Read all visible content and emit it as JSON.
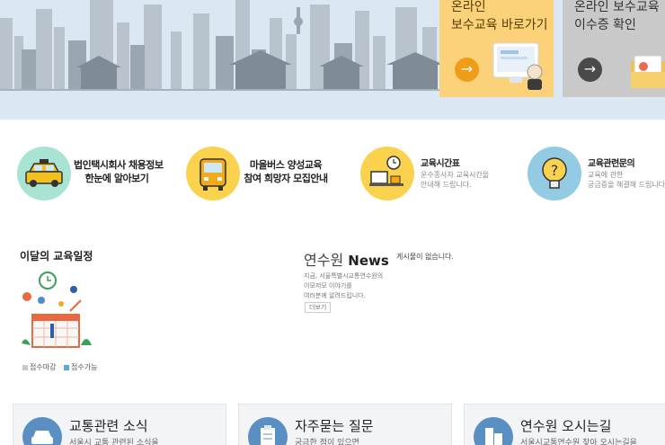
{
  "hero": {
    "cards": [
      {
        "line1": "온라인",
        "line2": "보수교육 바로가기",
        "arrow": "→"
      },
      {
        "line1": "온라인 보수교육",
        "line2": "이수증 확인",
        "arrow": "→"
      }
    ]
  },
  "quick_links": [
    {
      "line1": "법인택시회사 채용정보",
      "line2": "한눈에 알아보기",
      "icon": "taxi-icon"
    },
    {
      "line1": "마을버스 양성교육",
      "line2": "참여 희망자 모집안내",
      "icon": "bus-icon"
    },
    {
      "title": "교육시간표",
      "sub1": "운수종사자 교육시간을",
      "sub2": "안내해 드립니다.",
      "icon": "clock-desk-icon"
    },
    {
      "title": "교육관련문의",
      "sub1": "교육에 관한",
      "sub2": "궁금증을 해결해 드립니다.",
      "icon": "lightbulb-icon"
    }
  ],
  "schedule": {
    "title": "이달의 교육일정",
    "legend_closed": "접수마감",
    "legend_open": "접수가능"
  },
  "news": {
    "title_prefix": "연수원",
    "title_main": "News",
    "desc1": "지금, 서울특별시교통연수원의",
    "desc2": "이모저모 이야기를",
    "desc3": "여러분께 알려드립니다.",
    "more": "더보기",
    "empty": "게시물이 없습니다."
  },
  "bottom_cards": [
    {
      "title": "교통관련 소식",
      "sub": "서울시 교통 관련된 소식을"
    },
    {
      "title": "자주묻는 질문",
      "sub": "궁금한 점이 있으면"
    },
    {
      "title": "연수원 오시는길",
      "sub": "서울시교통연수원 찾아 오시는길을"
    }
  ],
  "colors": {
    "hero_bg": "#dbe8f4",
    "card_yellow": "#fbd27a",
    "card_gray": "#c9c9c9",
    "quick_mint": "#a9e3d3",
    "quick_yellow": "#fbd24e",
    "quick_blue": "#93cbe3",
    "legend_closed": "#c8c8c8",
    "legend_open": "#5aa9d6"
  }
}
